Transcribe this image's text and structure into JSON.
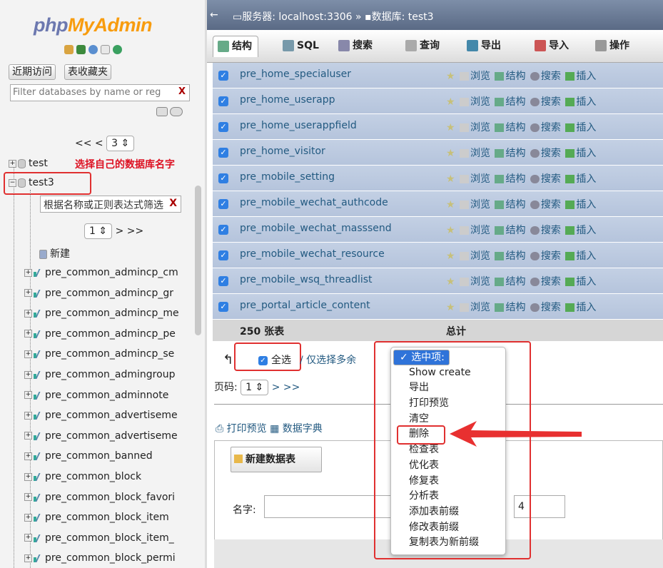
{
  "logo": {
    "p1": "php",
    "p2": "MyAdmin"
  },
  "left": {
    "recent": "近期访问",
    "favorites": "表收藏夹",
    "db_filter_placeholder": "Filter databases by name or reg",
    "clear": "X",
    "pager_prev": "<< <",
    "pager_page": "3",
    "annotation": "选择自己的数据库名字",
    "dbs": [
      "test",
      "test3"
    ],
    "tbl_filter_placeholder": "根据名称或正则表达式筛选",
    "pager2_page": "1",
    "pager2_next": "> >>",
    "new": "新建",
    "tables": [
      "pre_common_admincp_cm",
      "pre_common_admincp_gr",
      "pre_common_admincp_me",
      "pre_common_admincp_pe",
      "pre_common_admincp_se",
      "pre_common_admingroup",
      "pre_common_adminnote",
      "pre_common_advertiseme",
      "pre_common_advertiseme",
      "pre_common_banned",
      "pre_common_block",
      "pre_common_block_favori",
      "pre_common_block_item",
      "pre_common_block_item_",
      "pre_common_block_permi"
    ]
  },
  "breadcrumb": {
    "server": "服务器: localhost:3306",
    "sep": "»",
    "database": "数据库: test3"
  },
  "tabs": [
    {
      "label": "结构",
      "color": "#6a8"
    },
    {
      "label": "SQL",
      "color": "#79a"
    },
    {
      "label": "搜索",
      "color": "#88a"
    },
    {
      "label": "查询",
      "color": "#aaa"
    },
    {
      "label": "导出",
      "color": "#48a"
    },
    {
      "label": "导入",
      "color": "#c55"
    },
    {
      "label": "操作",
      "color": "#999"
    }
  ],
  "actions": {
    "browse": "浏览",
    "structure": "结构",
    "search": "搜索",
    "insert": "插入"
  },
  "rows": [
    "pre_home_specialuser",
    "pre_home_userapp",
    "pre_home_userappfield",
    "pre_home_visitor",
    "pre_mobile_setting",
    "pre_mobile_wechat_authcode",
    "pre_mobile_wechat_masssend",
    "pre_mobile_wechat_resource",
    "pre_mobile_wsq_threadlist",
    "pre_portal_article_content"
  ],
  "total": {
    "count": "250 张表",
    "label": "总计"
  },
  "bulk": {
    "select_all": "全选",
    "sep": "/",
    "select_overhead": "仅选择多余",
    "page_label": "页码:",
    "page": "1",
    "next": "> >>",
    "print": "打印预览",
    "dictionary": "数据字典"
  },
  "dropdown": {
    "selected": "选中项:",
    "options": [
      "Show create",
      "导出",
      "打印预览",
      "清空",
      "删除",
      "检查表",
      "优化表",
      "修复表",
      "分析表",
      "添加表前缀",
      "修改表前缀",
      "复制表为新前缀"
    ]
  },
  "create": {
    "button": "新建数据表",
    "name_label": "名字:",
    "columns_value": "4"
  }
}
